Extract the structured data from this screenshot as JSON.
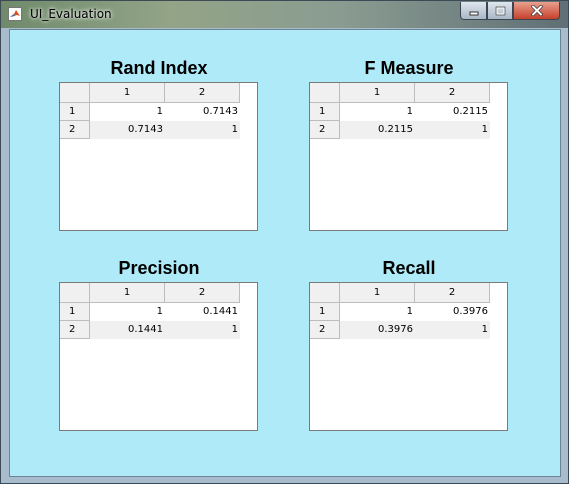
{
  "window": {
    "title": "UI_Evaluation",
    "controls": {
      "minimize_icon": "minimize-icon",
      "maximize_icon": "maximize-icon",
      "close_icon": "close-icon"
    }
  },
  "colors": {
    "client_background": "#aeeaf7",
    "table_header": "#f0f0f0",
    "close_button": "#c5412b"
  },
  "panels": [
    {
      "title": "Rand Index",
      "col_headers": [
        "1",
        "2"
      ],
      "rows": [
        {
          "label": "1",
          "values": [
            "1",
            "0.7143"
          ]
        },
        {
          "label": "2",
          "values": [
            "0.7143",
            "1"
          ]
        }
      ]
    },
    {
      "title": "F Measure",
      "col_headers": [
        "1",
        "2"
      ],
      "rows": [
        {
          "label": "1",
          "values": [
            "1",
            "0.2115"
          ]
        },
        {
          "label": "2",
          "values": [
            "0.2115",
            "1"
          ]
        }
      ]
    },
    {
      "title": "Precision",
      "col_headers": [
        "1",
        "2"
      ],
      "rows": [
        {
          "label": "1",
          "values": [
            "1",
            "0.1441"
          ]
        },
        {
          "label": "2",
          "values": [
            "0.1441",
            "1"
          ]
        }
      ]
    },
    {
      "title": "Recall",
      "col_headers": [
        "1",
        "2"
      ],
      "rows": [
        {
          "label": "1",
          "values": [
            "1",
            "0.3976"
          ]
        },
        {
          "label": "2",
          "values": [
            "0.3976",
            "1"
          ]
        }
      ]
    }
  ]
}
